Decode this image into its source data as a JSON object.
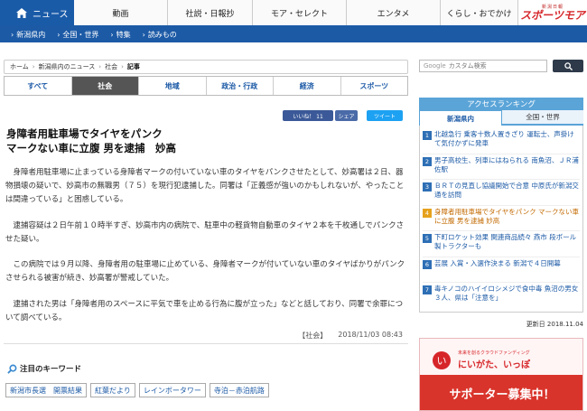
{
  "topnav": {
    "home": "ニュース",
    "items": [
      "動画",
      "社説・日報抄",
      "モア・セレクト",
      "エンタメ",
      "くらし・おでかけ"
    ],
    "logo_small": "新潟日報",
    "logo_big": "スポーツモア"
  },
  "subnav": {
    "items": [
      "新潟県内",
      "全国・世界",
      "特集",
      "読みもの"
    ]
  },
  "breadcrumb": {
    "items": [
      "ホーム",
      "新潟県内のニュース",
      "社会",
      "記事"
    ]
  },
  "search": {
    "placeholder": "カスタム検索",
    "brand": "Google"
  },
  "category_tabs": [
    "すべて",
    "社会",
    "地域",
    "政治・行政",
    "経済",
    "スポーツ"
  ],
  "share": {
    "like": "いいね！ 11",
    "share": "シェア",
    "tweet": "ツイート"
  },
  "article": {
    "headline_line1": "身障者用駐車場でタイヤをパンク",
    "headline_line2": "マークない車に立腹 男を逮捕　妙高",
    "paragraphs": [
      "身障者用駐車場に止まっている身障者マークの付いていない車のタイヤをパンクさせたとして、妙高署は２日、器物損壊の疑いで、妙高市の無職男（７５）を現行犯逮捕した。同署は「正義感が強いのかもしれないが、やったことは間違っている」と困惑している。",
      "逮捕容疑は２日午前１０時半すぎ、妙高市内の病院で、駐車中の軽貨物自動車のタイヤ２本を千枚通しでパンクさせた疑い。",
      "この病院では９月以降、身障者用の駐車場に止めている、身障者マークが付いていない車のタイヤばかりがパンクさせられる被害が続き、妙高署が警戒していた。",
      "逮捕された男は「身障者用のスペースに平気で車を止める行為に腹が立った」などと話しており、同署で余罪について調べている。"
    ],
    "category": "【社会】",
    "timestamp": "2018/11/03 08:43"
  },
  "keywords": {
    "title": "注目のキーワード",
    "items": [
      "新潟市長選　開票結果",
      "紅葉だより",
      "レインボータワー",
      "寺泊－赤泊航路"
    ]
  },
  "ranking": {
    "title": "アクセスランキング",
    "tabs": [
      "新潟県内",
      "全国・世界"
    ],
    "items": [
      {
        "rank": "1",
        "text": "北越急行 乗客十数人置きざり 運転士、声掛けて気付かずに発車"
      },
      {
        "rank": "2",
        "text": "男子高校生、列車にはねられる 南魚沼、ＪＲ浦佐駅"
      },
      {
        "rank": "3",
        "text": "ＢＲＴの見直し協議開始で合意 中原氏が新潟交通を訪問"
      },
      {
        "rank": "4",
        "text": "身障者用駐車場でタイヤをパンク マークない車に立腹 男を逮捕 妙高"
      },
      {
        "rank": "5",
        "text": "下町ロケット効果 関連商品続々 燕市 段ボール製トラクターも"
      },
      {
        "rank": "6",
        "text": "芸展 入賞・入選作決まる 新潟で４日開幕"
      },
      {
        "rank": "7",
        "text": "毒キノコのハイイロシメジで食中毒 魚沼の男女３人、県は「注意を」"
      }
    ],
    "updated": "更新日 2018.11.04"
  },
  "banner": {
    "small": "未来を創るクラウドファンディング",
    "main": "にいがた、いっぽ",
    "sub": "サポーター募集中！",
    "mark": "い"
  },
  "colors": {
    "brand_blue": "#1c5aa6",
    "ranking_blue": "#5aa4d8",
    "highlight": "#e6a21d",
    "banner_red": "#d9342b"
  }
}
